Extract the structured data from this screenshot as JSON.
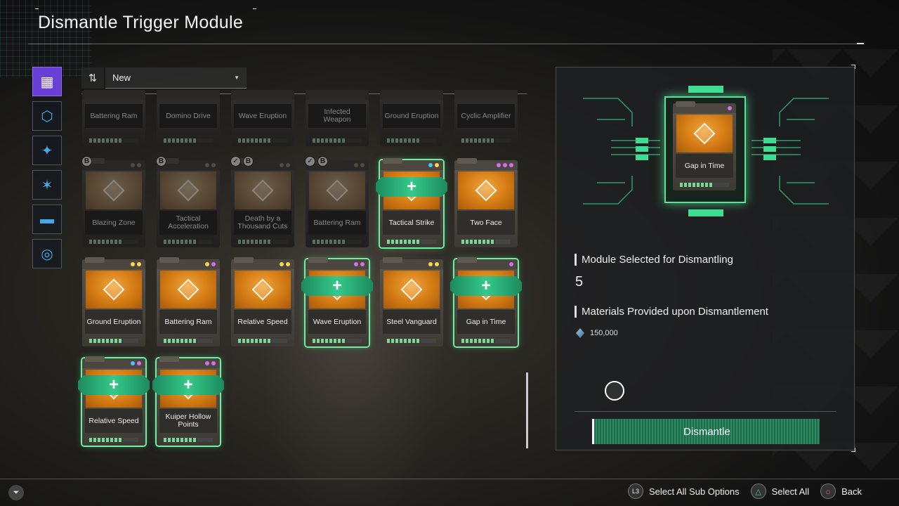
{
  "page": {
    "title": "Dismantle Trigger Module"
  },
  "sort": {
    "selected": "New"
  },
  "side_tabs": [
    {
      "icon": "layers-icon"
    },
    {
      "icon": "core-hex-icon"
    },
    {
      "icon": "rune-icon"
    },
    {
      "icon": "spark-icon"
    },
    {
      "icon": "vehicle-icon"
    },
    {
      "icon": "disc-icon"
    }
  ],
  "modules": [
    {
      "name": "Battering Ram",
      "dim": true,
      "selected": false
    },
    {
      "name": "Domino Drive",
      "dim": true,
      "selected": false
    },
    {
      "name": "Wave Eruption",
      "dim": true,
      "selected": false
    },
    {
      "name": "Infected Weapon",
      "dim": true,
      "selected": false
    },
    {
      "name": "Ground Eruption",
      "dim": true,
      "selected": false
    },
    {
      "name": "Cyclic Amplifier",
      "dim": true,
      "selected": false
    },
    {
      "name": "Blazing Zone",
      "dim": true,
      "selected": false,
      "badges": [
        "B"
      ]
    },
    {
      "name": "Tactical Acceleration",
      "dim": true,
      "selected": false,
      "badges": [
        "B"
      ]
    },
    {
      "name": "Death by a Thousand Cuts",
      "dim": true,
      "selected": false,
      "badges": [
        "✓",
        "B"
      ]
    },
    {
      "name": "Battering Ram",
      "dim": true,
      "selected": false,
      "badges": [
        "✓",
        "B"
      ]
    },
    {
      "name": "Tactical Strike",
      "dim": false,
      "selected": true,
      "dots": [
        "#4fc3f7",
        "#ffd54f"
      ]
    },
    {
      "name": "Two Face",
      "dim": false,
      "selected": false,
      "dots": [
        "#d070f0",
        "#d070f0",
        "#d070f0"
      ]
    },
    {
      "name": "Ground Eruption",
      "dim": false,
      "selected": false,
      "dots": [
        "#ffd54f",
        "#ffd54f"
      ]
    },
    {
      "name": "Battering Ram",
      "dim": false,
      "selected": false,
      "dots": [
        "#ffd54f",
        "#d070f0"
      ]
    },
    {
      "name": "Relative Speed",
      "dim": false,
      "selected": false,
      "dots": [
        "#ffd54f",
        "#ffd54f"
      ]
    },
    {
      "name": "Wave Eruption",
      "dim": false,
      "selected": true,
      "dots": [
        "#d070f0",
        "#d070f0"
      ]
    },
    {
      "name": "Steel Vanguard",
      "dim": false,
      "selected": false,
      "dots": [
        "#ffd54f",
        "#ffd54f"
      ]
    },
    {
      "name": "Gap in Time",
      "dim": false,
      "selected": true,
      "dots": [
        "#d070f0"
      ]
    },
    {
      "name": "Relative Speed",
      "dim": false,
      "selected": true,
      "dots": [
        "#4fc3f7",
        "#d070f0"
      ]
    },
    {
      "name": "Kuiper Hollow Points",
      "dim": false,
      "selected": true,
      "dots": [
        "#d070f0",
        "#d070f0"
      ]
    }
  ],
  "preview": {
    "name": "Gap in Time",
    "dots": [
      "#d070f0"
    ]
  },
  "panel": {
    "selected_label": "Module Selected for Dismantling",
    "selected_count": "5",
    "materials_label": "Materials Provided upon Dismantlement",
    "material_amount": "150,000",
    "material_icon": "crystal-icon",
    "dismantle_label": "Dismantle"
  },
  "footer": {
    "hints": [
      {
        "glyph": "L3",
        "label": "Select All Sub Options"
      },
      {
        "glyph": "△",
        "label": "Select All"
      },
      {
        "glyph": "○",
        "label": "Back"
      }
    ]
  },
  "colors": {
    "accent": "#55e39a",
    "tab_active": "#6a3fd6",
    "art": "#d27a14"
  }
}
